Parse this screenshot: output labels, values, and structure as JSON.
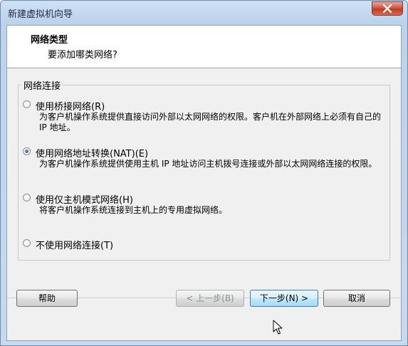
{
  "window": {
    "title": "新建虚拟机向导"
  },
  "header": {
    "title": "网络类型",
    "subtitle": "要添加哪类网络?"
  },
  "network_group": {
    "label": "网络连接",
    "options": [
      {
        "label": "使用桥接网络(R)",
        "description": "为客户机操作系统提供直接访问外部以太网网络的权限。客户机在外部网络上必须有自己的 IP 地址。",
        "checked": false
      },
      {
        "label": "使用网络地址转换(NAT)(E)",
        "description": "为客户机操作系统提供使用主机 IP 地址访问主机拨号连接或外部以太网网络连接的权限。",
        "checked": true
      },
      {
        "label": "使用仅主机模式网络(H)",
        "description": "将客户机操作系统连接到主机上的专用虚拟网络。",
        "checked": false
      },
      {
        "label": "不使用网络连接(T)",
        "description": "",
        "checked": false
      }
    ]
  },
  "buttons": {
    "help": "帮助",
    "back": "< 上一步(B)",
    "next": "下一步(N) >",
    "cancel": "取消"
  },
  "icons": {
    "close": "close-icon",
    "cursor": "mouse-pointer-icon"
  },
  "colors": {
    "title_bar": "#c6d9ee",
    "close_button": "#c23b22",
    "default_button_border": "#3c7fb1",
    "dialog_background": "#f0f0f0"
  }
}
